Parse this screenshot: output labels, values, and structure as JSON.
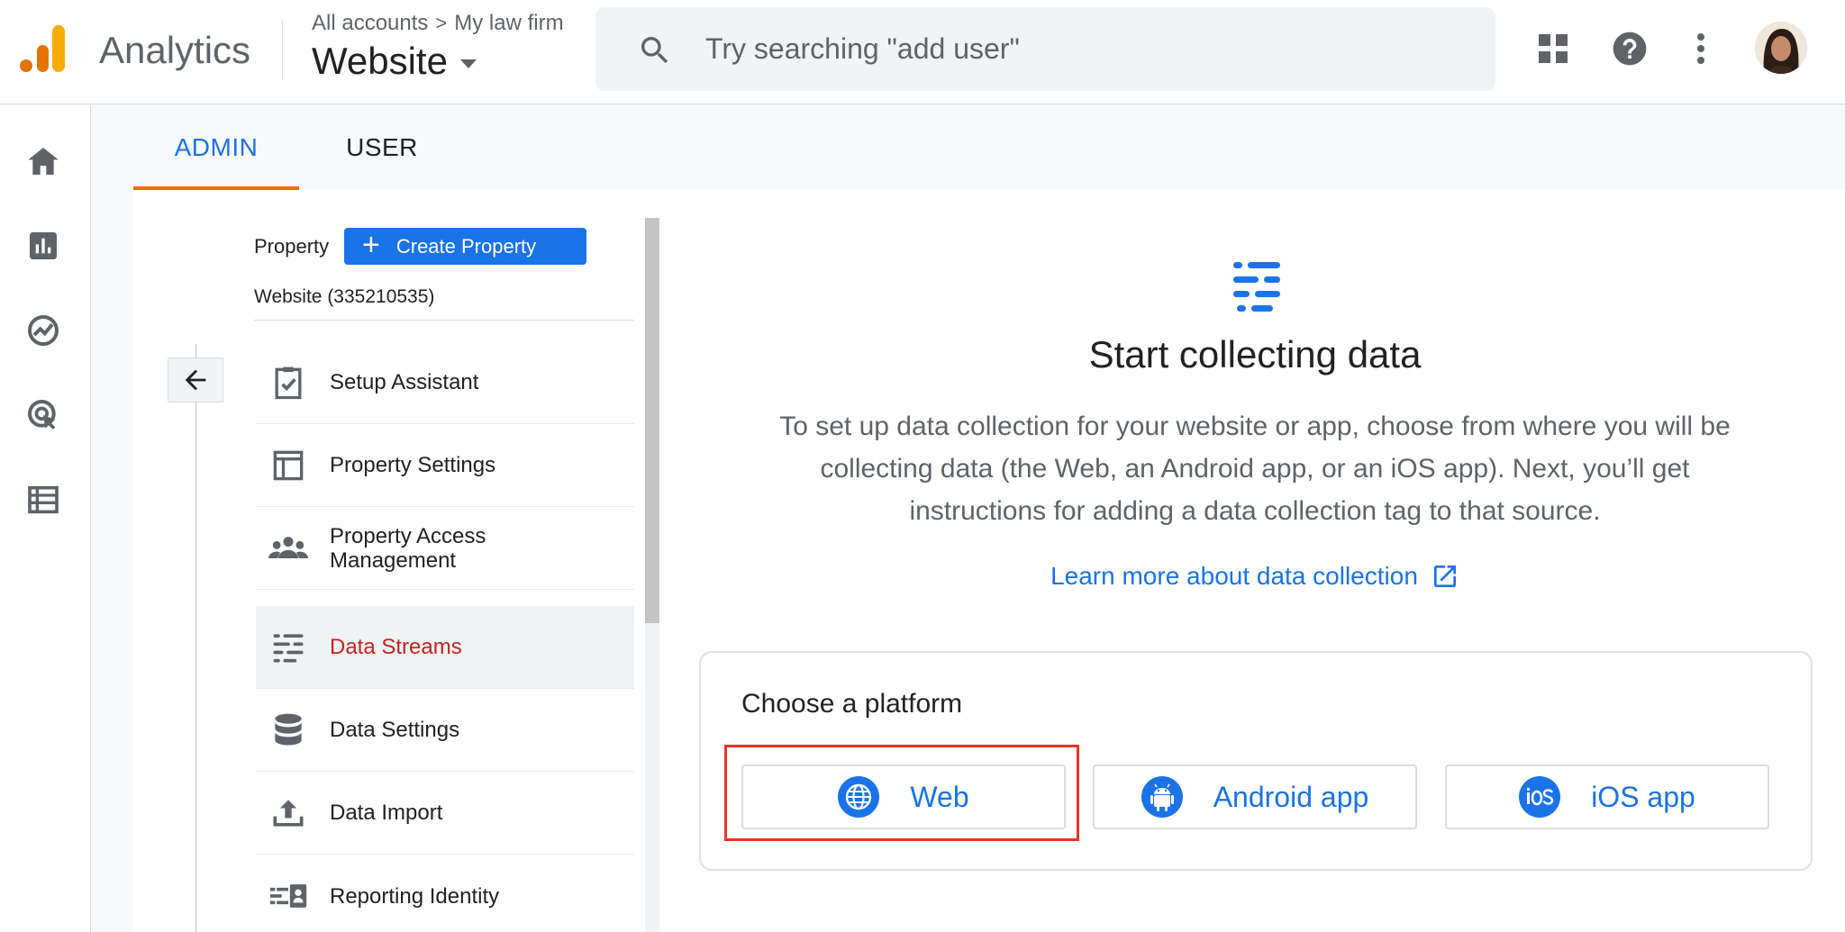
{
  "header": {
    "brand": "Analytics",
    "breadcrumb": {
      "accounts": "All accounts",
      "separator": ">",
      "account": "My law firm"
    },
    "property_title": "Website",
    "search": {
      "placeholder": "Try searching \"add user\"",
      "value": ""
    },
    "icons": [
      "apps-grid-icon",
      "help-icon",
      "more-vert-icon",
      "avatar"
    ],
    "logo_colors": [
      "#f9ab00",
      "#e37400"
    ]
  },
  "nav_rail": {
    "icons": [
      "home-icon",
      "reports-icon",
      "explore-icon",
      "advertising-icon",
      "configure-icon"
    ]
  },
  "tabs": [
    {
      "label": "ADMIN",
      "active": true
    },
    {
      "label": "USER",
      "active": false
    }
  ],
  "property_panel": {
    "label": "Property",
    "create_button": {
      "plus": "+",
      "label": "Create Property"
    },
    "property_name": "Website (335210535)",
    "items": [
      {
        "label": "Setup Assistant",
        "icon": "checklist-icon"
      },
      {
        "label": "Property Settings",
        "icon": "property-settings-icon"
      },
      {
        "label": "Property Access Management",
        "icon": "people-icon"
      },
      {
        "label": "Data Streams",
        "icon": "data-streams-icon",
        "selected": true
      },
      {
        "label": "Data Settings",
        "icon": "database-icon"
      },
      {
        "label": "Data Import",
        "icon": "upload-icon"
      },
      {
        "label": "Reporting Identity",
        "icon": "reporting-identity-icon"
      }
    ]
  },
  "main": {
    "title": "Start collecting data",
    "description": "To set up data collection for your website or app, choose from where you will be collecting data (the Web, an Android app, or an iOS app). Next, you’ll get instructions for adding a data collection tag to that source.",
    "learn_more": "Learn more about data collection",
    "platform": {
      "title": "Choose a platform",
      "options": [
        {
          "label": "Web",
          "icon": "globe-icon"
        },
        {
          "label": "Android app",
          "icon": "android-icon"
        },
        {
          "label": "iOS app",
          "icon": "ios-icon"
        }
      ]
    }
  },
  "colors": {
    "accent_blue": "#1a73e8",
    "tab_underline": "#e8710a",
    "selected_text": "#c5221f",
    "highlight_box": "#e8351f"
  }
}
